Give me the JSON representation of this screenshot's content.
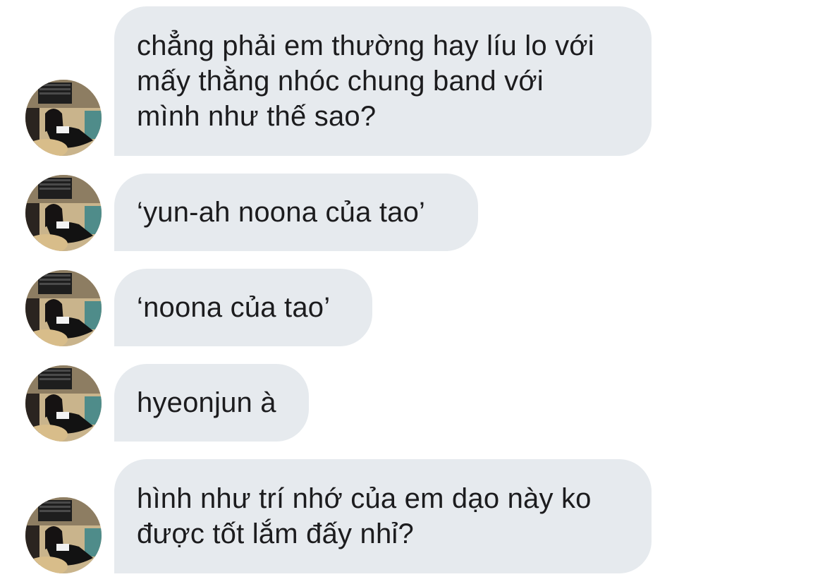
{
  "conversation": {
    "messages": [
      {
        "text": "chẳng phải em thường hay líu lo với\nmấy thằng nhóc chung band với\nmình như thế sao?"
      },
      {
        "text": "‘yun-ah noona của tao’"
      },
      {
        "text": "‘noona của tao’"
      },
      {
        "text": "hyeonjun à"
      },
      {
        "text": "hình như trí nhớ của em dạo này ko\nđược tốt lắm đấy nhỉ?"
      }
    ]
  },
  "colors": {
    "bubble_background": "#e6eaee",
    "text": "#1c1c1e",
    "page_background": "#ffffff"
  },
  "icons": {
    "avatar": "profile-photo-icon"
  }
}
